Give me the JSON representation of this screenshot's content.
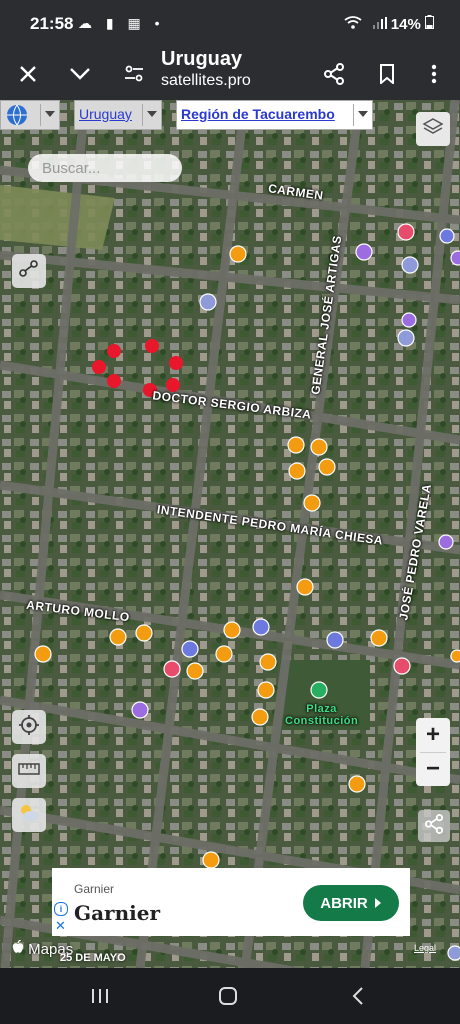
{
  "status": {
    "time": "21:58",
    "battery": "14%",
    "left_icons": "☁ ▮ ▦ •"
  },
  "toolbar": {
    "title": "Uruguay",
    "subtitle": "satellites.pro"
  },
  "map_controls": {
    "country": "Uruguay",
    "region": "Región de Tacuarembo",
    "search_placeholder": "Buscar...",
    "zoom_in": "+",
    "zoom_out": "−"
  },
  "streets": {
    "carmen": "CARMEN",
    "artigas": "GENERAL JOSÉ ARTIGAS",
    "arbiza": "DOCTOR SERGIO ARBIZA",
    "chiesa": "INTENDENTE PEDRO MARÍA CHIESA",
    "varela": "JOSÉ PEDRO VARELA",
    "mollo": "ARTURO MOLLO",
    "plaza": "Plaza\nConstitución",
    "mayo": "25 DE MAYO"
  },
  "ad": {
    "brand_small": "Garnier",
    "brand_big": "Garnier",
    "cta": "ABRIR"
  },
  "attribution": {
    "maps": "Mapas",
    "legal": "Legal"
  },
  "colors": {
    "toolbar": "#2b2d31",
    "ad_button": "#137a48",
    "link_blue": "#2a3ad0",
    "poi_orange": "#f39c12",
    "route_red": "#e8172b"
  }
}
